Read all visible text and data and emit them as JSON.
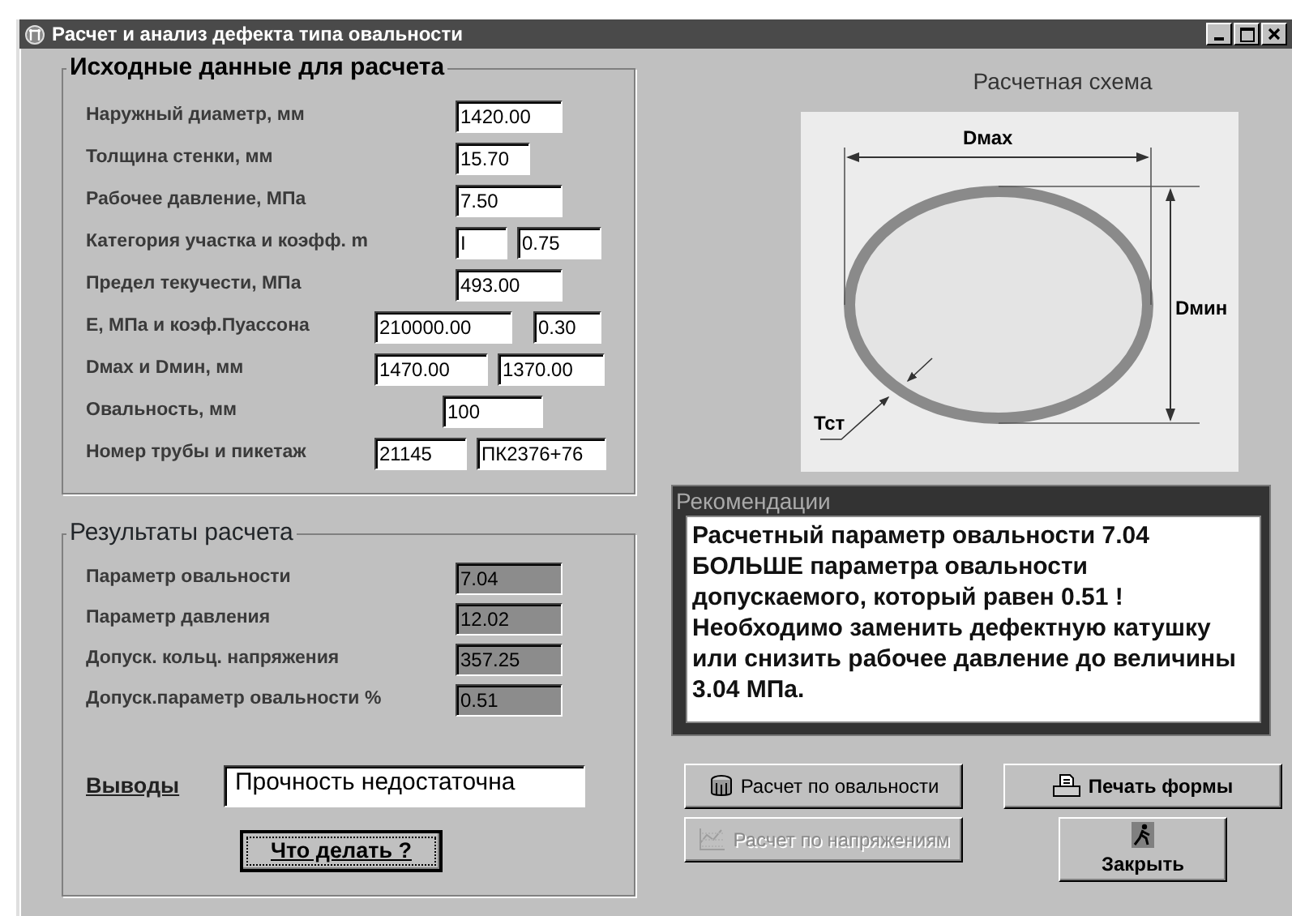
{
  "window": {
    "title": "Расчет и анализ дефекта типа овальности"
  },
  "input_group": {
    "title": "Исходные данные для расчета",
    "rows": [
      {
        "label": "Наружный диаметр, мм",
        "values": [
          "1420.00"
        ]
      },
      {
        "label": "Толщина стенки, мм",
        "values": [
          "15.70"
        ]
      },
      {
        "label": "Рабочее давление, МПа",
        "values": [
          "7.50"
        ]
      },
      {
        "label": "Категория участка и коэфф. m",
        "values": [
          "I",
          "0.75"
        ]
      },
      {
        "label": "Предел текучести, МПа",
        "values": [
          "493.00"
        ]
      },
      {
        "label": "E, МПа и коэф.Пуассона",
        "values": [
          "210000.00",
          "0.30"
        ]
      },
      {
        "label": "Dмах и Dмин, мм",
        "values": [
          "1470.00",
          "1370.00"
        ]
      },
      {
        "label": "Овальность, мм",
        "values": [
          "100"
        ]
      },
      {
        "label": "Номер трубы и пикетаж",
        "values": [
          "21145",
          "ПК2376+76"
        ]
      }
    ]
  },
  "results_group": {
    "title": "Результаты расчета",
    "rows": [
      {
        "label": "Параметр овальности",
        "value": "7.04"
      },
      {
        "label": "Параметр давления",
        "value": "12.02"
      },
      {
        "label": "Допуск. кольц. напряжения",
        "value": "357.25"
      },
      {
        "label": "Допуск.параметр овальности %",
        "value": "0.51"
      }
    ],
    "conclusion_label": "Выводы",
    "conclusion_value": "Прочность недостаточна",
    "action_button": "Что делать ?"
  },
  "scheme": {
    "title": "Расчетная схема",
    "dmax_label": "Dмах",
    "dmin_label": "Dмин",
    "wall_label": "Тст"
  },
  "recommendations": {
    "title": "Рекомендации",
    "text": " Расчетный параметр овальности 7.04 БОЛЬШЕ параметра овальности допускаемого, который равен 0.51 ! Необходимо заменить дефектную катушку или снизить рабочее давление до величины 3.04 МПа."
  },
  "buttons": [
    {
      "label": "Расчет по овальности",
      "disabled": false
    },
    {
      "label": "Печать формы",
      "disabled": false
    },
    {
      "label": "Расчет по напряжениям",
      "disabled": true
    },
    {
      "label": "Закрыть",
      "disabled": false
    }
  ]
}
